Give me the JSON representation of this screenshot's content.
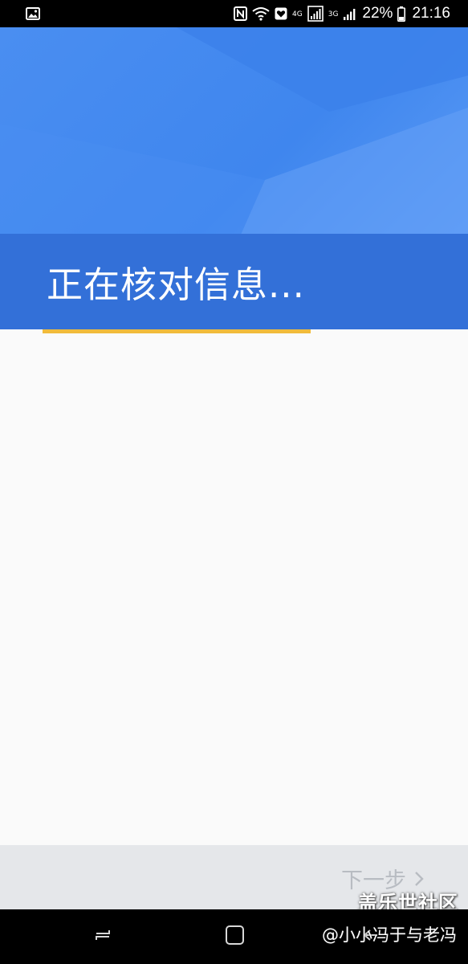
{
  "status_bar": {
    "network_label_1": "4G",
    "network_label_2": "3G",
    "battery_percent": "22%",
    "time": "21:16",
    "icons": [
      "gallery-icon",
      "nfc-icon",
      "wifi-icon",
      "heart-box-icon",
      "signal-icon",
      "signal-icon",
      "battery-icon"
    ]
  },
  "header": {
    "title": "正在核对信息..."
  },
  "progress": {
    "fraction": 0.63,
    "color": "#f1bb3b"
  },
  "footer": {
    "next_label": "下一步",
    "next_icon": "chevron-right-icon"
  },
  "watermark": {
    "forum": "盖乐世社区",
    "user": "@小小冯于与老冯"
  },
  "nav_bar": {
    "icons": [
      "recent-apps-icon",
      "home-icon",
      "back-icon"
    ]
  },
  "colors": {
    "header_blue": "#4a8ef1",
    "title_band": "#3370d8",
    "accent_yellow": "#f1bb3b",
    "next_disabled": "#b8bcc2"
  }
}
